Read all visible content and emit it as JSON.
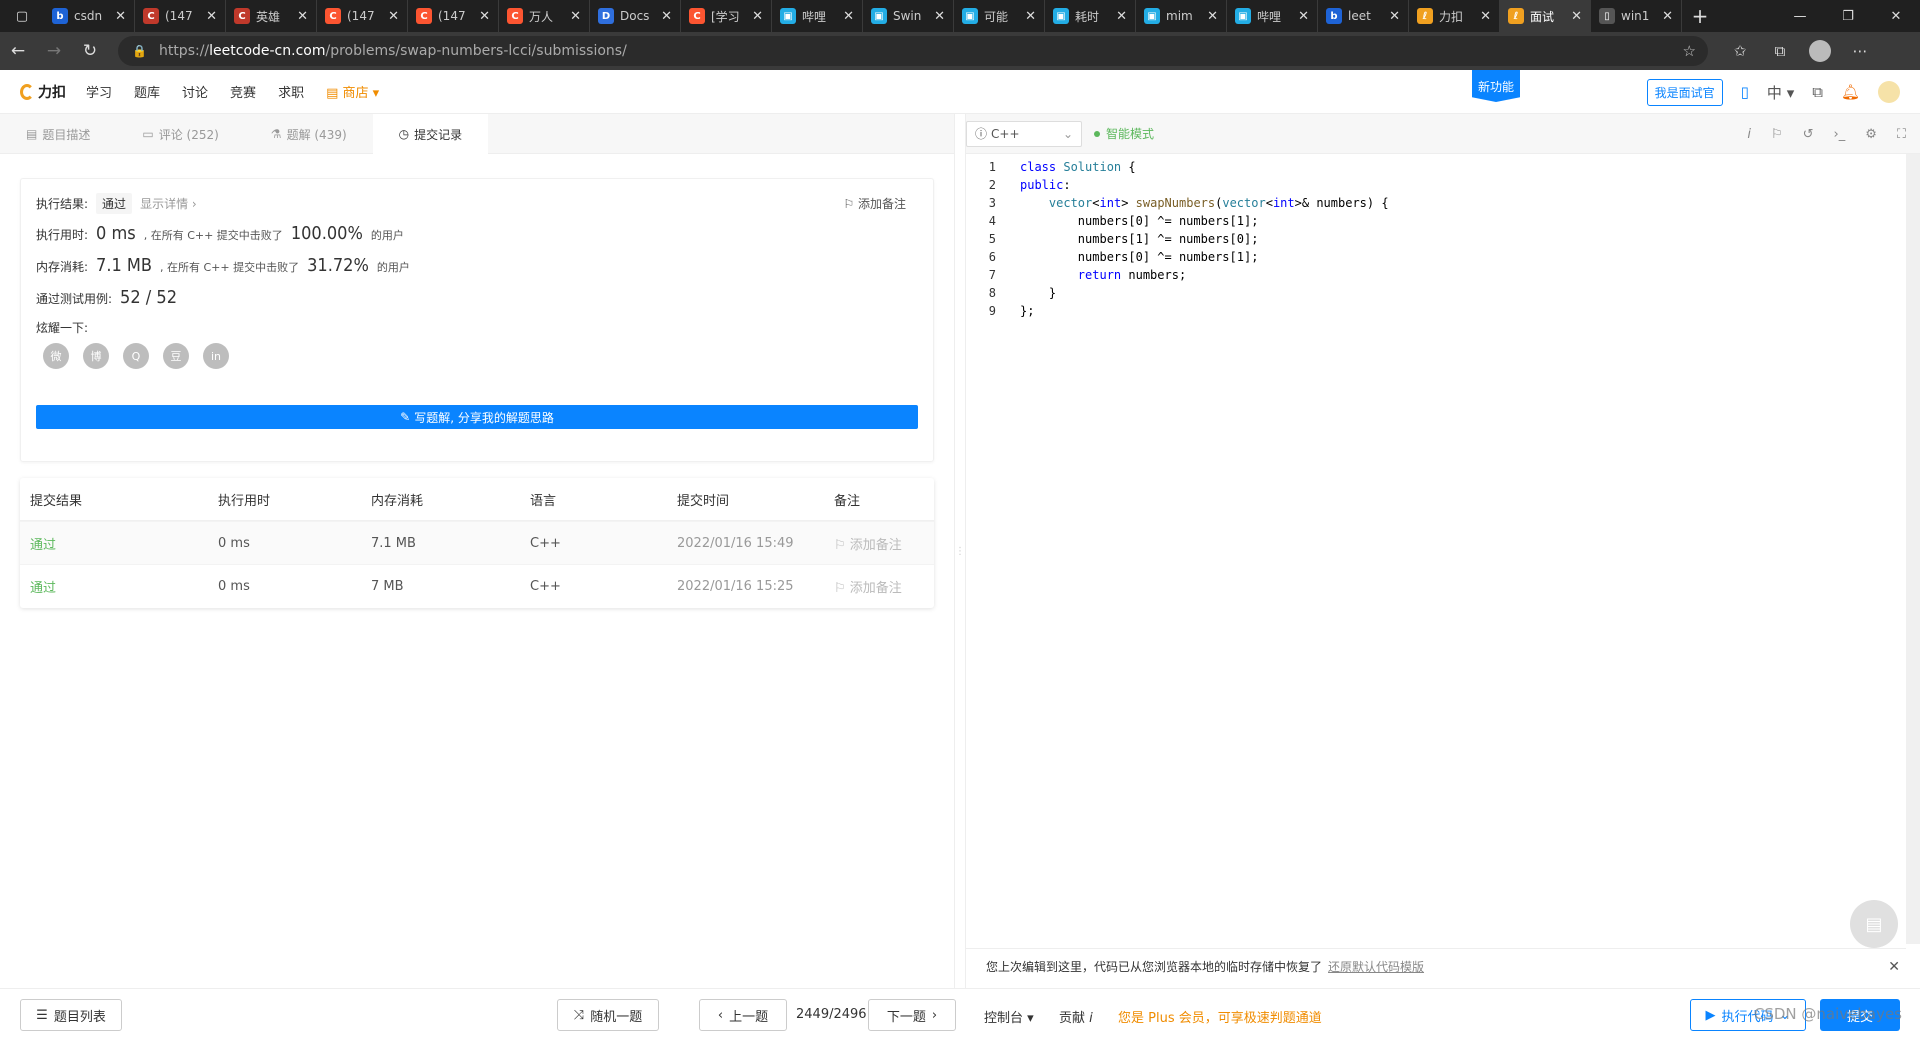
{
  "browser": {
    "tabs": [
      {
        "title": "csdn",
        "color": "#1e63d6",
        "glyph": "b"
      },
      {
        "title": "(147",
        "color": "#c0392b",
        "glyph": "C"
      },
      {
        "title": "英雄",
        "color": "#c0392b",
        "glyph": "C"
      },
      {
        "title": "(147",
        "color": "#fc5531",
        "glyph": "C"
      },
      {
        "title": "(147",
        "color": "#fc5531",
        "glyph": "C"
      },
      {
        "title": "万人",
        "color": "#fc5531",
        "glyph": "C"
      },
      {
        "title": "Docs",
        "color": "#2f6fde",
        "glyph": "D"
      },
      {
        "title": "[学习",
        "color": "#fc5531",
        "glyph": "C"
      },
      {
        "title": "哔哩",
        "color": "#23ade5",
        "glyph": "▣"
      },
      {
        "title": "Swin",
        "color": "#23ade5",
        "glyph": "▣"
      },
      {
        "title": "可能",
        "color": "#23ade5",
        "glyph": "▣"
      },
      {
        "title": "耗时",
        "color": "#23ade5",
        "glyph": "▣"
      },
      {
        "title": "mim",
        "color": "#23ade5",
        "glyph": "▣"
      },
      {
        "title": "哔哩",
        "color": "#23ade5",
        "glyph": "▣"
      },
      {
        "title": "leet",
        "color": "#1e63d6",
        "glyph": "b"
      },
      {
        "title": "力扣",
        "color": "#f0a020",
        "glyph": "ℓ"
      },
      {
        "title": "面试",
        "color": "#f0a020",
        "glyph": "ℓ",
        "active": true
      },
      {
        "title": "win1",
        "color": "#555",
        "glyph": "▯"
      }
    ],
    "url_prefix": "https://",
    "url_host": "leetcode-cn.com",
    "url_path": "/problems/swap-numbers-lcci/submissions/"
  },
  "header": {
    "logo": "力扣",
    "nav": [
      "学习",
      "题库",
      "讨论",
      "竞赛",
      "求职"
    ],
    "shop": "商店",
    "new_feature": "新功能",
    "interviewer": "我是面试官",
    "lang": "中"
  },
  "left_tabs": [
    {
      "icon": "▤",
      "label": "题目描述"
    },
    {
      "icon": "▭",
      "label": "评论 (252)"
    },
    {
      "icon": "⚗",
      "label": "题解 (439)"
    },
    {
      "icon": "◷",
      "label": "提交记录",
      "active": true
    }
  ],
  "result": {
    "label_result": "执行结果:",
    "status": "通过",
    "show_detail": "显示详情 ›",
    "add_note": "添加备注",
    "label_time": "执行用时:",
    "time_value": "0 ms",
    "time_desc": ", 在所有 C++ 提交中击败了",
    "time_pct": "100.00%",
    "users_suffix": "的用户",
    "label_mem": "内存消耗:",
    "mem_value": "7.1 MB",
    "mem_desc": ", 在所有 C++ 提交中击败了",
    "mem_pct": "31.72%",
    "label_cases": "通过测试用例:",
    "cases_value": "52 / 52",
    "label_share": "炫耀一下:",
    "share": [
      "微",
      "博",
      "Q",
      "豆",
      "in"
    ],
    "write_solution": "写题解, 分享我的解题思路"
  },
  "submissions": {
    "headers": [
      "提交结果",
      "执行用时",
      "内存消耗",
      "语言",
      "提交时间",
      "备注"
    ],
    "rows": [
      {
        "result": "通过",
        "time": "0 ms",
        "mem": "7.1 MB",
        "lang": "C++",
        "submitted": "2022/01/16 15:49",
        "note": "添加备注"
      },
      {
        "result": "通过",
        "time": "0 ms",
        "mem": "7 MB",
        "lang": "C++",
        "submitted": "2022/01/16 15:25",
        "note": "添加备注"
      }
    ]
  },
  "editor": {
    "language": "C++",
    "smart_mode": "智能模式",
    "line_numbers": [
      "1",
      "2",
      "3",
      "4",
      "5",
      "6",
      "7",
      "8",
      "9"
    ],
    "restore_msg": "您上次编辑到这里，代码已从您浏览器本地的临时存储中恢复了",
    "restore_link": "还原默认代码模版"
  },
  "bottom": {
    "problem_list": "题目列表",
    "random": "随机一题",
    "prev": "上一题",
    "page": "2449/2496",
    "next": "下一题",
    "console": "控制台",
    "contribute": "贡献",
    "plus_note": "您是 Plus 会员，可享极速判题通道",
    "run": "执行代码",
    "submit": "提交",
    "watermark": "CSDN @naivebayes"
  }
}
